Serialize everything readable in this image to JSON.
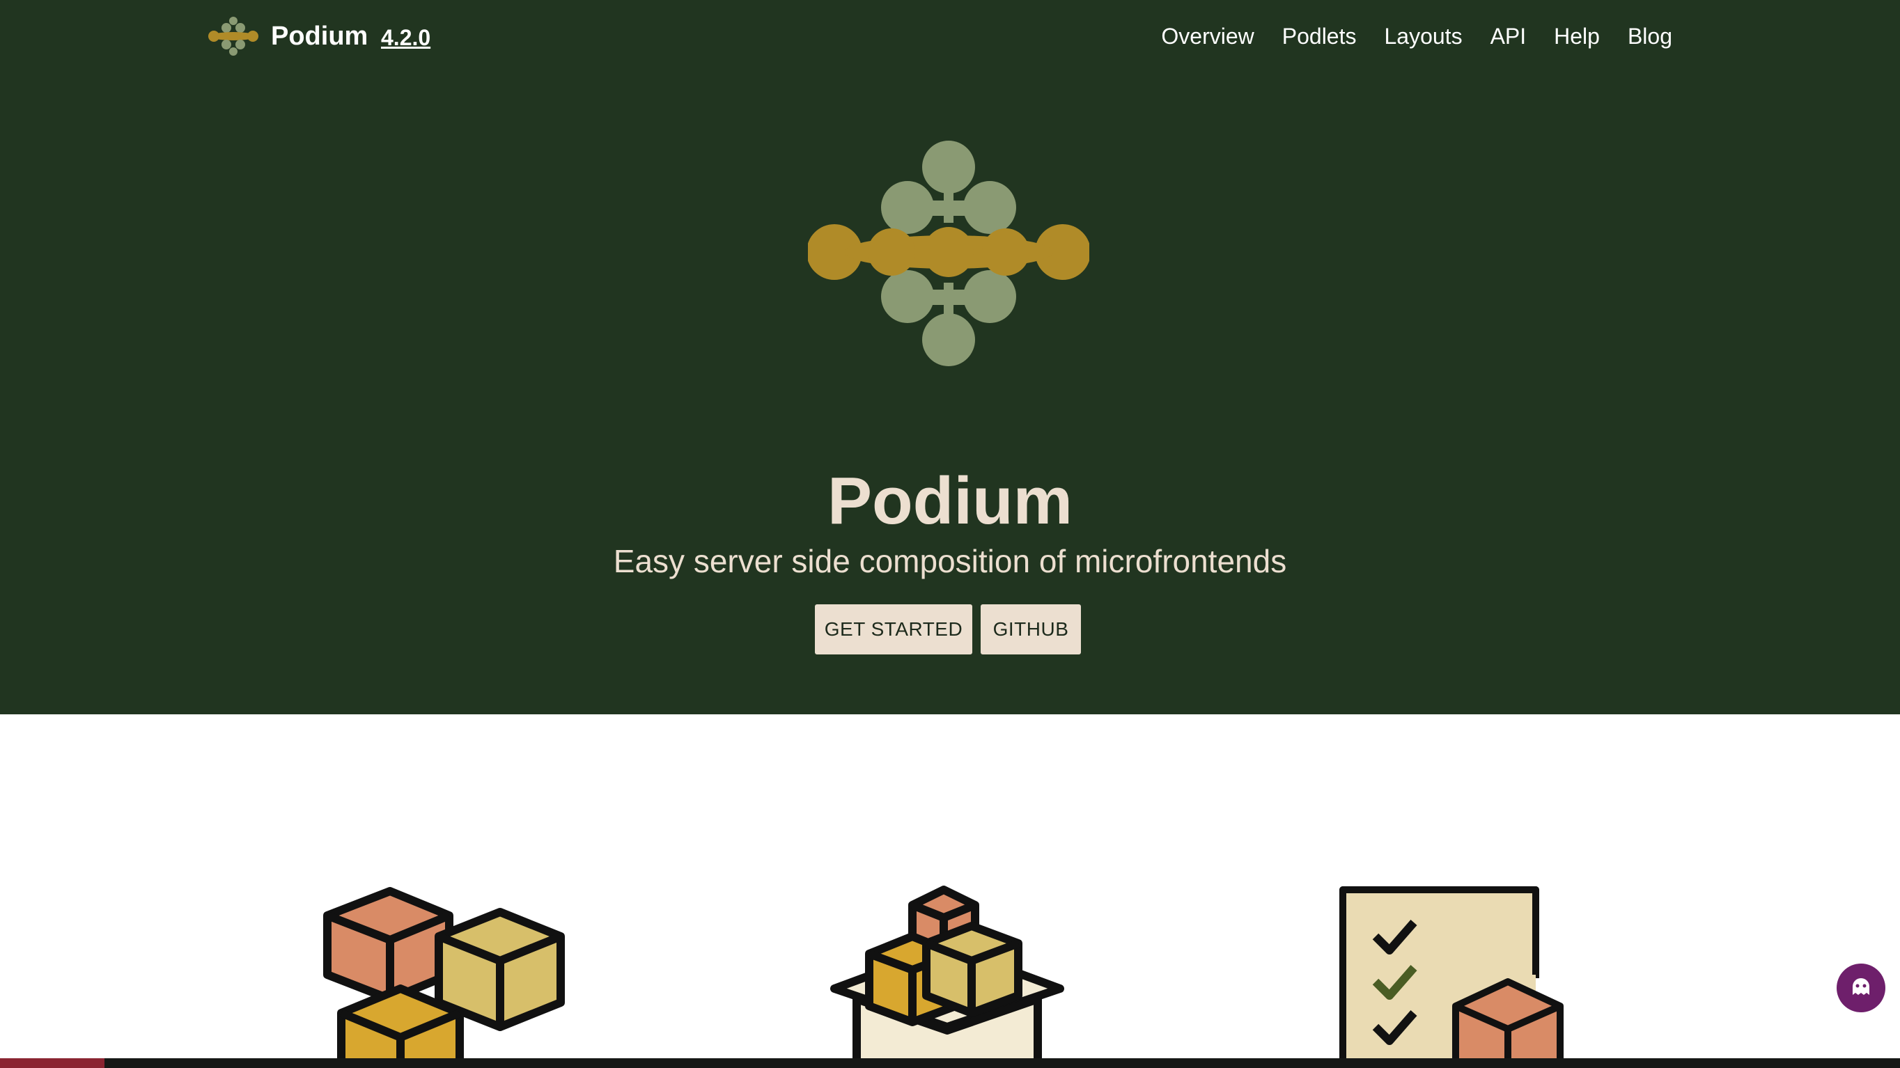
{
  "navbar": {
    "brand_name": "Podium",
    "version": "4.2.0",
    "links": [
      {
        "label": "Overview"
      },
      {
        "label": "Podlets"
      },
      {
        "label": "Layouts"
      },
      {
        "label": "API"
      },
      {
        "label": "Help"
      },
      {
        "label": "Blog"
      }
    ]
  },
  "hero": {
    "title": "Podium",
    "tagline": "Easy server side composition of microfrontends",
    "buttons": {
      "get_started": "GET STARTED",
      "github": "GITHUB"
    }
  },
  "features": [
    {
      "icon": "stacked-boxes-icon"
    },
    {
      "icon": "open-box-icon"
    },
    {
      "icon": "checklist-box-icon"
    }
  ],
  "feedback": {
    "icon": "ghost-chat-icon"
  },
  "colors": {
    "hero_background": "#213520",
    "hero_text": "#ecdfd0",
    "button_background": "#ecdfd0",
    "logo_gold": "#b08b28",
    "logo_sage": "#8a9a73",
    "feedback_purple": "#6e1f6b"
  }
}
